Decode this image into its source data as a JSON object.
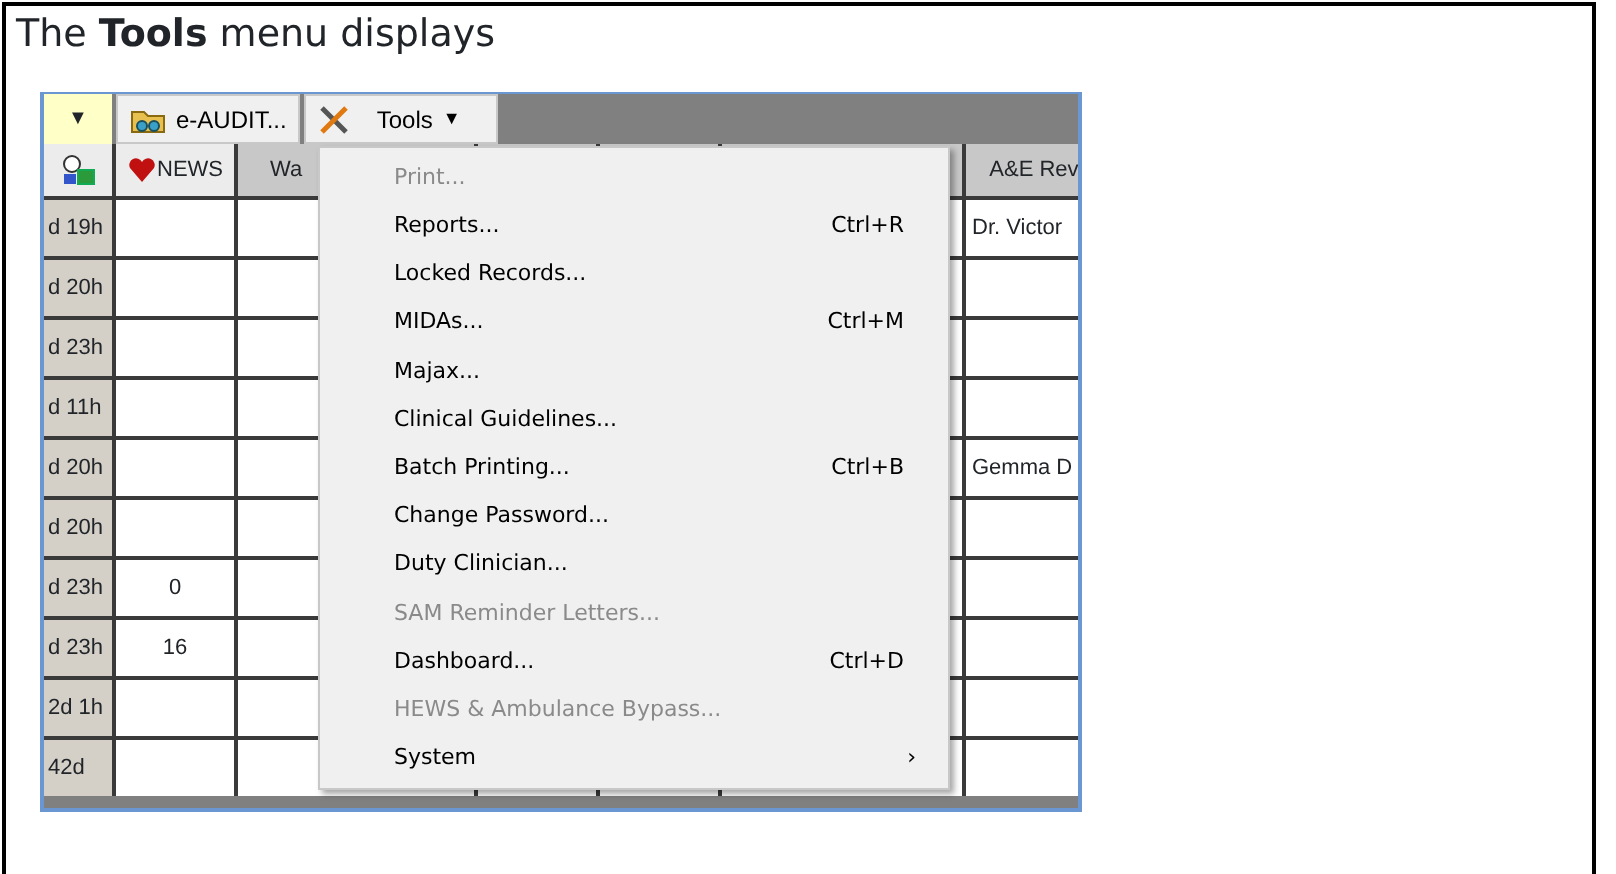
{
  "heading": "The **Tools** menu displays",
  "toolbar": {
    "dropdown_arrow": "▼",
    "audit_button": {
      "label": "e-AUDIT..."
    },
    "tools_button": {
      "label": "Tools",
      "arrow": "▼"
    }
  },
  "table": {
    "columns": [
      "NEWS",
      "Wa",
      "A&E Rev"
    ],
    "rows": [
      {
        "age": "d 19h",
        "a_e_rev": "Dr. Victor"
      },
      {
        "age": "d 20h"
      },
      {
        "age": "d 23h"
      },
      {
        "age": "d 11h"
      },
      {
        "age": "d 20h",
        "a_e_rev": "Gemma D"
      },
      {
        "age": "d 20h"
      },
      {
        "age": "d 23h",
        "news": "0"
      },
      {
        "age": "d 23h",
        "news": "16"
      },
      {
        "age": "2d 1h"
      },
      {
        "age": "42d"
      }
    ]
  },
  "menu": [
    {
      "label": "Print...",
      "disabled": true
    },
    {
      "label": "Reports...",
      "shortcut": "Ctrl+R",
      "disabled": false
    },
    {
      "label": "Locked Records...",
      "disabled": false
    },
    {
      "label": "MIDAs...",
      "shortcut": "Ctrl+M",
      "disabled": false
    },
    {
      "label": "Majax...",
      "disabled": false
    },
    {
      "label": "Clinical Guidelines...",
      "disabled": false
    },
    {
      "label": "Batch Printing...",
      "shortcut": "Ctrl+B",
      "disabled": false
    },
    {
      "label": "Change Password...",
      "disabled": false
    },
    {
      "label": "Duty Clinician...",
      "disabled": false
    },
    {
      "label": "SAM Reminder Letters...",
      "disabled": true
    },
    {
      "label": "Dashboard...",
      "shortcut": "Ctrl+D",
      "disabled": false
    },
    {
      "label": "HEWS & Ambulance Bypass...",
      "disabled": true
    },
    {
      "label": "System",
      "submenu_arrow": "›",
      "disabled": false
    }
  ]
}
